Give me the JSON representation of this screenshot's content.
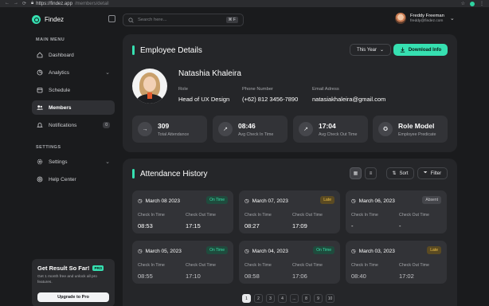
{
  "browser": {
    "url_host": "https://findez.app",
    "url_path": "/members/detail"
  },
  "app": {
    "name": "Findez"
  },
  "sidebar": {
    "main_menu_title": "MAIN MENU",
    "items": [
      {
        "label": "Dashboard",
        "icon": "home-icon"
      },
      {
        "label": "Analytics",
        "icon": "chart-icon"
      },
      {
        "label": "Schedule",
        "icon": "calendar-icon"
      },
      {
        "label": "Members",
        "icon": "users-icon",
        "active": true
      },
      {
        "label": "Notifications",
        "icon": "bell-icon",
        "badge": "0"
      }
    ],
    "settings_title": "SETTINGS",
    "settings_items": [
      {
        "label": "Settings",
        "icon": "gear-icon"
      },
      {
        "label": "Help Center",
        "icon": "help-icon"
      }
    ]
  },
  "promo": {
    "title": "Get Result So Far!",
    "badge": "PRO",
    "description": "Get 1 month free and unlock all pro features.",
    "button": "Upgrade to Pro"
  },
  "search": {
    "placeholder": "Search here...",
    "shortcut": "⌘ F"
  },
  "user": {
    "name": "Freddy Freeman",
    "email": "freddy@findez.com"
  },
  "employee_details": {
    "title": "Employee Details",
    "period": "This Year",
    "download_label": "Download Info",
    "name": "Natashia Khaleira",
    "role_label": "Role",
    "role": "Head of UX Design",
    "phone_label": "Phone Number",
    "phone": "(+62) 812 3456-7890",
    "email_label": "Email Adress",
    "email": "natasiakhaleira@gmail.com",
    "stats": [
      {
        "value": "309",
        "label": "Total Attendance",
        "icon": "arrow-in-icon"
      },
      {
        "value": "08:46",
        "label": "Avg Check In Time",
        "icon": "clock-check-icon"
      },
      {
        "value": "17:04",
        "label": "Avg Check Out Time",
        "icon": "arrow-out-icon"
      },
      {
        "value": "Role Model",
        "label": "Employee Predicate",
        "icon": "badge-icon"
      }
    ]
  },
  "attendance": {
    "title": "Attendance History",
    "sort_label": "Sort",
    "filter_label": "Filter",
    "check_in_label": "Check In Time",
    "check_out_label": "Check Out Time",
    "records": [
      {
        "date": "March 08 2023",
        "status": "On Time",
        "status_kind": "on",
        "check_in": "08:53",
        "check_out": "17:15"
      },
      {
        "date": "March 07, 2023",
        "status": "Late",
        "status_kind": "late",
        "check_in": "08:27",
        "check_out": "17:09"
      },
      {
        "date": "March 06, 2023",
        "status": "Absent",
        "status_kind": "absent",
        "check_in": "-",
        "check_out": "-"
      },
      {
        "date": "March 05, 2023",
        "status": "On Time",
        "status_kind": "on",
        "check_in": "08:55",
        "check_out": "17:10"
      },
      {
        "date": "March 04, 2023",
        "status": "On Time",
        "status_kind": "on",
        "check_in": "08:58",
        "check_out": "17:06"
      },
      {
        "date": "March 03, 2023",
        "status": "Late",
        "status_kind": "late",
        "check_in": "08:40",
        "check_out": "17:02"
      }
    ]
  },
  "pagination": {
    "pages": [
      "1",
      "2",
      "3",
      "4",
      "...",
      "8",
      "9",
      "10"
    ],
    "active": "1"
  },
  "colors": {
    "accent": "#36e0b1",
    "background": "#1a1b1d",
    "card": "#252629"
  }
}
